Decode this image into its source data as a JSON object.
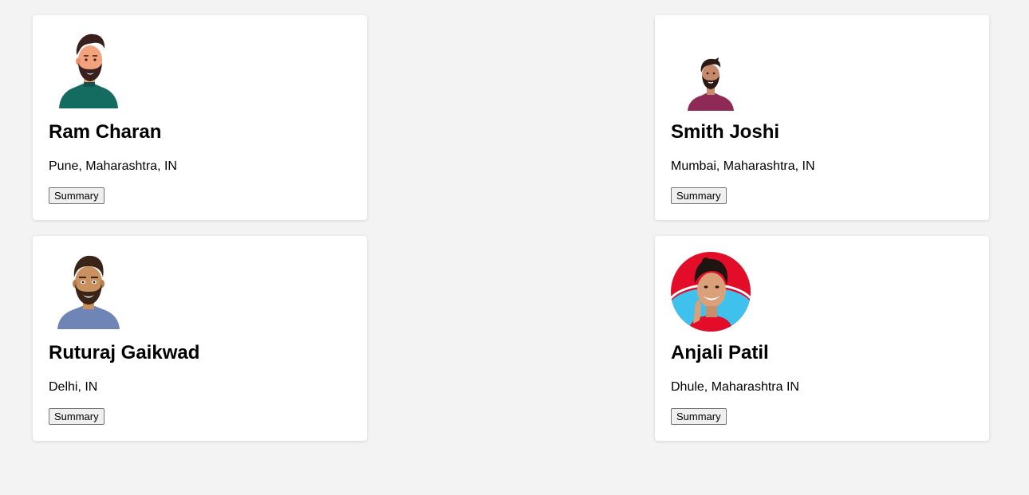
{
  "profiles": [
    {
      "name": "Ram Charan",
      "location": "Pune, Maharashtra, IN",
      "button": "Summary",
      "avatar": "male-avatar-green-icon",
      "colors": {
        "shirt": "#146b5f",
        "skin": "#f4a27c",
        "hair": "#3a1f1f"
      }
    },
    {
      "name": "Smith Joshi",
      "location": "Mumbai, Maharashtra, IN",
      "button": "Summary",
      "avatar": "male-avatar-purple-icon",
      "colors": {
        "shirt": "#8e2a55",
        "skin": "#c68a6a",
        "hair": "#2b1a14"
      }
    },
    {
      "name": "Ruturaj Gaikwad",
      "location": "Delhi, IN",
      "button": "Summary",
      "avatar": "male-avatar-blue-icon",
      "colors": {
        "shirt": "#6f85b5",
        "skin": "#c9915f",
        "hair": "#3a2417"
      }
    },
    {
      "name": "Anjali Patil",
      "location": "Dhule, Maharashtra IN",
      "button": "Summary",
      "avatar": "female-photo-avatar",
      "colors": {
        "bg_top": "#e30d2a",
        "bg_bottom": "#3fc1ee",
        "skin": "#d9a07a",
        "hair": "#1e1410"
      }
    }
  ]
}
